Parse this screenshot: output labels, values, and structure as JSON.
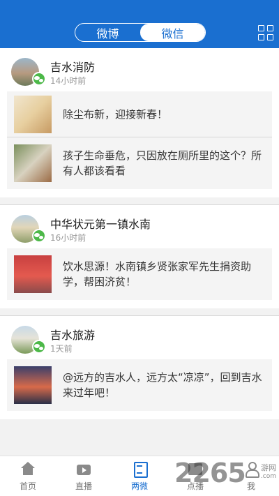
{
  "header": {
    "tabs": [
      {
        "label": "微博",
        "active": false
      },
      {
        "label": "微信",
        "active": true
      }
    ],
    "grid_icon": "grid-menu-icon",
    "color": "#1a6fd0"
  },
  "accounts": [
    {
      "name": "吉水消防",
      "time": "14小时前",
      "articles": [
        {
          "title": "除尘布新，迎接新春！"
        },
        {
          "title": "孩子生命垂危，只因放在厕所里的这个？所有人都该看看"
        }
      ]
    },
    {
      "name": "中华状元第一镇水南",
      "time": "16小时前",
      "articles": [
        {
          "title": "饮水思源！水南镇乡贤张家军先生捐资助学，帮困济贫！"
        }
      ]
    },
    {
      "name": "吉水旅游",
      "time": "1天前",
      "articles": [
        {
          "title": "@远方的吉水人，远方太“凉凉”，回到吉水来过年吧！"
        }
      ]
    }
  ],
  "tabbar": {
    "items": [
      {
        "label": "首页",
        "icon": "home-icon"
      },
      {
        "label": "直播",
        "icon": "tv-icon"
      },
      {
        "label": "两微",
        "icon": "news-icon",
        "active": true
      },
      {
        "label": "点播",
        "icon": "video-icon"
      },
      {
        "label": "我",
        "icon": "profile-icon"
      }
    ]
  },
  "watermark": {
    "number": "2265",
    "text": "游网",
    "sub": ".com"
  }
}
